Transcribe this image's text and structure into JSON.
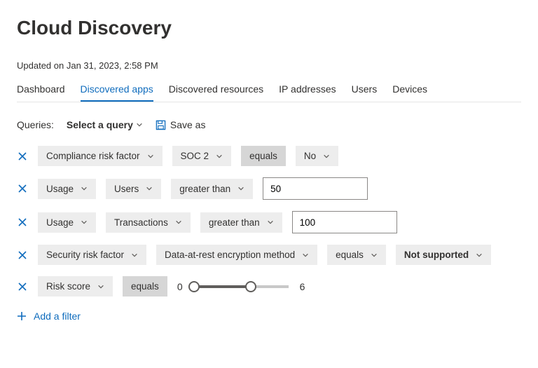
{
  "title": "Cloud Discovery",
  "updated": "Updated on Jan 31, 2023, 2:58 PM",
  "tabs": [
    {
      "label": "Dashboard",
      "active": false
    },
    {
      "label": "Discovered apps",
      "active": true
    },
    {
      "label": "Discovered resources",
      "active": false
    },
    {
      "label": "IP addresses",
      "active": false
    },
    {
      "label": "Users",
      "active": false
    },
    {
      "label": "Devices",
      "active": false
    }
  ],
  "queries": {
    "label": "Queries:",
    "select_label": "Select a query",
    "save_as": "Save as"
  },
  "filters": [
    {
      "field": "Compliance risk factor",
      "subfield": "SOC 2",
      "operator": "equals",
      "operator_dark": true,
      "value_pill": "No"
    },
    {
      "field": "Usage",
      "subfield": "Users",
      "operator": "greater than",
      "value_input": "50"
    },
    {
      "field": "Usage",
      "subfield": "Transactions",
      "operator": "greater than",
      "value_input": "100"
    },
    {
      "field": "Security risk factor",
      "subfield": "Data-at-rest encryption method",
      "operator": "equals",
      "value_pill": "Not supported",
      "value_bold": true
    },
    {
      "field": "Risk score",
      "operator": "equals",
      "operator_dark": true,
      "slider": {
        "min_display": 0,
        "max_display": 6,
        "low": 0,
        "high": 6,
        "range_max": 10
      }
    }
  ],
  "add_filter": "Add a filter",
  "colors": {
    "accent": "#0f6cbd",
    "pill": "#ededed",
    "pill_dark": "#d6d6d6"
  }
}
